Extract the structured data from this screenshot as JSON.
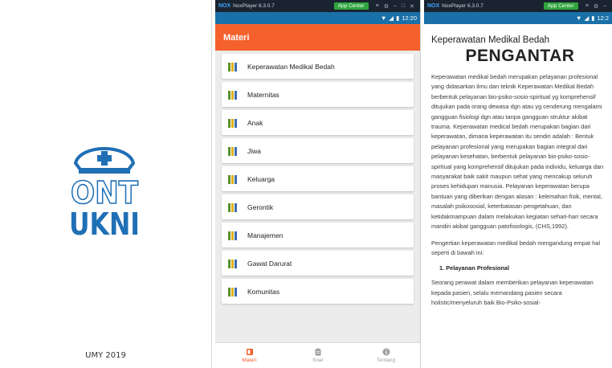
{
  "splash": {
    "logo_top": "ONT",
    "logo_bottom": "UKNI",
    "footer": "UMY 2019"
  },
  "player": {
    "logo": "NOX",
    "title": "NoxPlayer 6.3.0.7",
    "app_center": "App Center"
  },
  "status": {
    "time": "12:20",
    "time_cropped": "12:2"
  },
  "menu": {
    "appbar_title": "Materi",
    "items": [
      {
        "label": "Keperawatan Medikal Bedah"
      },
      {
        "label": "Maternitas"
      },
      {
        "label": "Anak"
      },
      {
        "label": "Jiwa"
      },
      {
        "label": "Keluarga"
      },
      {
        "label": "Gerontik"
      },
      {
        "label": "Manajemen"
      },
      {
        "label": "Gawat Darurat"
      },
      {
        "label": "Komunitas"
      }
    ],
    "nav": [
      {
        "label": "Materi",
        "icon": "book-icon",
        "active": true
      },
      {
        "label": "Soal",
        "icon": "clipboard-icon",
        "active": false
      },
      {
        "label": "Tentang",
        "icon": "info-icon",
        "active": false
      }
    ]
  },
  "article": {
    "title": "Keperawatan Medikal Bedah",
    "heading": "PENGANTAR",
    "para1": "Keperawatan medikal bedah merupakan pelayanan profesional yang didasarkan ilmu dan teknik Keperawatan Medikal Bedah berbentuk pelayanan bio-psiko-sosio-spiritual yg komprehensif ditujukan pada orang dewasa dgn atau yg cenderung mengalami gangguan fisiologi dgn atau tanpa gangguan struktur akibat trauma. Keperawatan medical bedah merupakan bagian dari keperawatan, dimana keperawatan itu sendiri adalah : Bentuk pelayanan profesional yang merupakan bagian integral dari pelayanan kesehatan, berbentuk pelayanan bio-psiko-sosio-spiritual yang komprehensif ditujukan pada individu, keluarga dan masyarakat baik sakit maupun sehat yang mencakup seluruh proses kehidupan manusia. Pelayanan keperawatan berupa bantuan yang diberikan dengan alasan : kelemahan fisik, mental, masalah psikososial, keterbatasan pengetahuan, dan ketidakmampuan dalam melakukan kegiatan sehari-hari secara mandiri akibat gangguan patofisiologis, (CHS,1992).",
    "para2": "Pengertian keperawatan medikal bedah mengandung empat hal seperti di bawah ini:",
    "list_item": "1. Pelayanan Profesional",
    "para3": "Seorang perawat dalam memberikan pelayanan keperawatan kepada pasien, selalu memandang pasien secara holistic/menyeluruh baik Bio-Psiko-sosial-"
  },
  "colors": {
    "accent": "#f5612d",
    "logo_blue": "#1f6fb5",
    "status_blue": "#1a70a8",
    "player_bg": "#1a2431"
  }
}
